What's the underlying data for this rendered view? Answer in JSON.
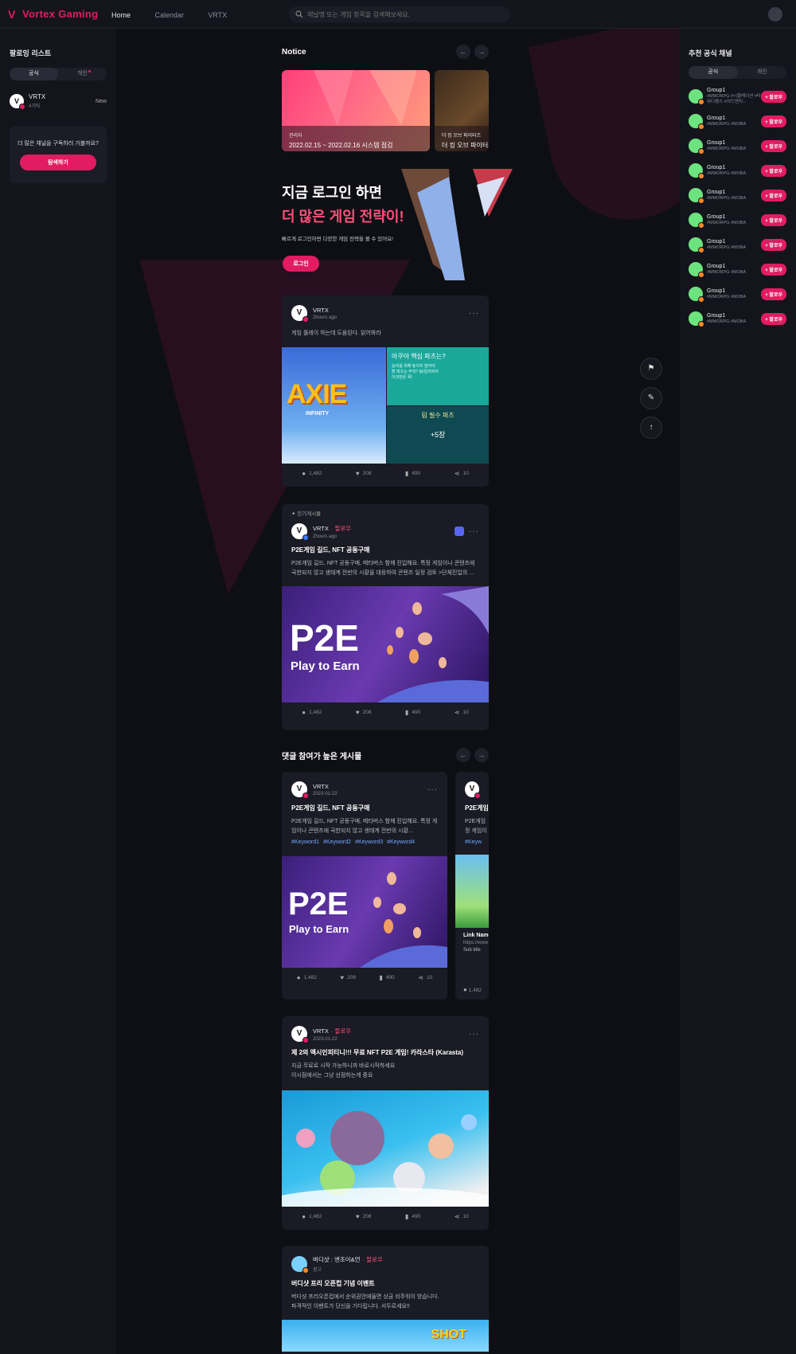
{
  "app": {
    "name": "Vortex Gaming",
    "logo": "V"
  },
  "nav": {
    "home": "Home",
    "calendar": "Calendar",
    "vrtx": "VRTX"
  },
  "search": {
    "placeholder": "채널명 또는 게임 항목을 검색해보세요."
  },
  "left": {
    "title": "팔로잉 리스트",
    "tab_official": "공식",
    "tab_personal": "개인",
    "item": {
      "name": "VRTX",
      "sub": "#기타",
      "badge": "New"
    },
    "explore_text": "더 많은 채널을 구독하러 가볼까요?",
    "explore_button": "탐색하기"
  },
  "right": {
    "title": "추천 공식 채널",
    "tab_official": "공식",
    "tab_personal": "개인",
    "follow_label": "+ 팔로우",
    "items": [
      {
        "name": "Group1",
        "tags": "#MMORPG #시뮬레이션 #타워디펜스 #어드벤처..."
      },
      {
        "name": "Group1",
        "tags": "#MMORPG #MOBA"
      },
      {
        "name": "Group1",
        "tags": "#MMORPG #MOBA"
      },
      {
        "name": "Group1",
        "tags": "#MMORPG #MOBA"
      },
      {
        "name": "Group1",
        "tags": "#MMORPG #MOBA"
      },
      {
        "name": "Group1",
        "tags": "#MMORPG #MOBA"
      },
      {
        "name": "Group1",
        "tags": "#MMORPG #MOBA"
      },
      {
        "name": "Group1",
        "tags": "#MMORPG #MOBA"
      },
      {
        "name": "Group1",
        "tags": "#MMORPG #MOBA"
      },
      {
        "name": "Group1",
        "tags": "#MMORPG #MOBA"
      }
    ]
  },
  "notice": {
    "title": "Notice",
    "cards": [
      {
        "sub": "관리자",
        "title": "2022.02.15 ~ 2022.02.16 시스템 점검"
      },
      {
        "sub": "더 킹 오브 파이터즈",
        "title": "더 킹 오브 파이터즈"
      }
    ]
  },
  "hero": {
    "line1": "지금 로그인 하면",
    "line2": "더 많은 게임 전략이!",
    "sub": "빠르게 로그인하면 다양한 게임 전략을 볼 수 있어요!",
    "button": "로그인"
  },
  "posts": {
    "p1": {
      "name": "VRTX",
      "time": "2hours ago",
      "body": "게임 플레이 하는데 도움된다. 읽어봐라",
      "img_title": "AXIE",
      "img_sub": "INFINITY",
      "side1": "아쿠아 핵심 파츠는?",
      "side1_sub": "승리를 위해 놓치지 말아야 할 파츠는 무엇? 림/일러피아 이것만은 꼭!",
      "side2": "림 필수 파츠",
      "side2_sub": "+5장",
      "comments": "1,482",
      "likes": "208",
      "saves": "490",
      "shares": "10"
    },
    "p2": {
      "tag": "인기게시물",
      "name": "VRTX",
      "follow": "· 팔로우",
      "time": "2hours ago",
      "title": "P2E게임 길드, NFT 공동구매",
      "body": "P2E게임 길드, NFT 공동구매, 메타버스 함께 진입해요. 특정 게임이나 콘텐츠에 국한되지 않고 생태계 전반의 시황을 대응하여 콘텐츠 일정 검토 >단체진입의 ...",
      "img_title": "P2E",
      "img_sub": "Play to Earn",
      "comments": "1,482",
      "likes": "208",
      "saves": "490",
      "shares": "10"
    },
    "section_title": "댓글 참여가 높은 게시물",
    "p3": {
      "name": "VRTX",
      "time": "2023-01-22",
      "title": "P2E게임 길드, NFT 공동구매",
      "body": "P2E게임 길드, NFT 공동구매, 메타버스 함께 진입해요. 특정 게임이나 콘텐츠에 국한되지 않고 생태계 전반의 시황...",
      "tags": [
        "#Keyword1",
        "#Keyword2",
        "#Keyword3",
        "#Keyword4"
      ],
      "img_title": "P2E",
      "img_sub": "Play to Earn",
      "comments": "1,482",
      "likes": "208",
      "saves": "490",
      "shares": "10"
    },
    "p3b": {
      "title": "P2E게임",
      "body": "P2E게임",
      "body2": "정 게임이",
      "tags": "#Keyw",
      "link_name": "Link Name",
      "link_url": "https://www",
      "link_sub": "Sub title",
      "comments": "1,482"
    },
    "p4": {
      "name": "VRTX",
      "follow": "· 팔로우",
      "time": "2023-01-22",
      "title": "제 2의 엑시인피티니!!! 무료 NFT P2E 게임! 카라스타 (Karasta)",
      "body1": "지금 무료로 시작 가능하니까 바로시작하세요",
      "body2": "이시점에서는 그냥 선점하는게 중요",
      "comments": "1,482",
      "likes": "208",
      "saves": "490",
      "shares": "10"
    },
    "p5": {
      "name": "버디샷 : 엔조이&언",
      "follow": "· 팔로우",
      "time": "광고",
      "title": "버디샷 프리 오픈컵 기념 이벤트",
      "body1": "버디샷 프리오픈컵에서 순위권안에들면 상금 쉬주워이 방습니다.",
      "body2": "파격적인 이벤트가 당신을 기다립니다. 서두르세요!!",
      "img_label": "SHOT"
    }
  },
  "colors": {
    "accent": "#e21c61",
    "accent_light": "#ff4f7b",
    "link": "#6fa8ff"
  }
}
